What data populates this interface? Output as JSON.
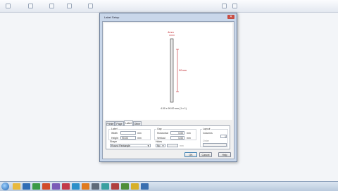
{
  "dialog": {
    "title": "Label Setup",
    "close_glyph": "✕"
  },
  "preview": {
    "width_label": "4mm",
    "height_label": "90mm",
    "footer": "4.00 x 90.00 mm (1 x 1)"
  },
  "tabs": [
    {
      "label": "Printer"
    },
    {
      "label": "Page"
    },
    {
      "label": "Label"
    },
    {
      "label": "Other"
    }
  ],
  "label_group": {
    "title": "Label",
    "width_label": "Width",
    "width_value": "",
    "width_unit": "mm",
    "height_label": "Height",
    "height_value": "90.00",
    "height_unit": "mm"
  },
  "gap_group": {
    "title": "Gap",
    "horizontal_label": "Horizontal",
    "horizontal_value": "0.00",
    "horizontal_unit": "mm",
    "vertical_label": "Vertical",
    "vertical_value": "0.00",
    "vertical_unit": "mm"
  },
  "layout_group": {
    "title": "Layout",
    "columns_label": "Columns",
    "columns_value": "1",
    "order_label": "Order"
  },
  "shape": {
    "title": "Shape",
    "value": "Round Rectangle"
  },
  "holes": {
    "title": "Holes",
    "value": "No",
    "unit": "mm"
  },
  "buttons": {
    "ok": "OK",
    "cancel": "Cancel",
    "help": "Help"
  },
  "taskbar": {
    "time": ""
  }
}
